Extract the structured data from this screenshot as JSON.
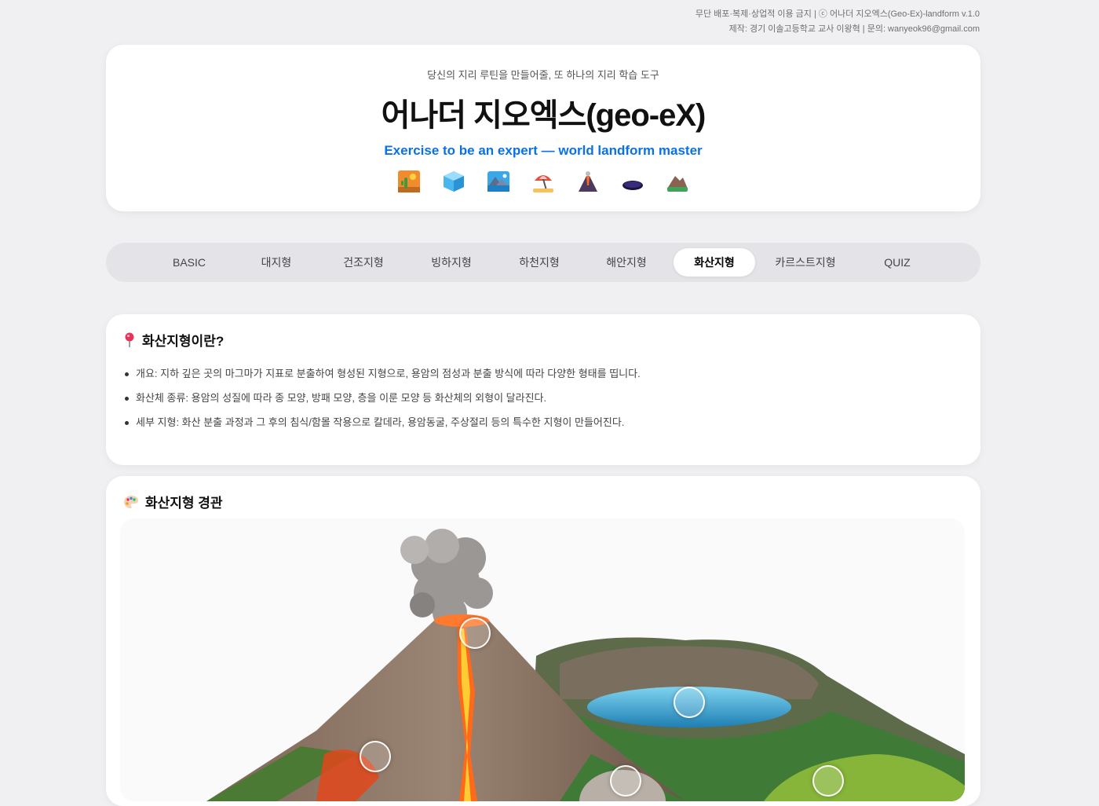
{
  "copyright": {
    "line1": "무단 배포·복제·상업적 이용 금지 | ⓒ 어나더 지오엑스(Geo-Ex)-landform v.1.0",
    "line2": "제작: 경기 이솔고등학교 교사 이왕혁 | 문의: wanyeok96@gmail.com"
  },
  "hero": {
    "tagline": "당신의 지리 루틴을 만들어줄, 또 하나의 지리 학습 도구",
    "title": "어나더 지오엑스(geo-eX)",
    "subtitle": "Exercise to be an expert — world landform master",
    "icons": [
      "desert-icon",
      "ice-cube-icon",
      "landscape-icon",
      "beach-umbrella-icon",
      "volcano-icon",
      "hole-icon",
      "mountain-icon"
    ]
  },
  "tabs": [
    {
      "label": "BASIC",
      "active": false
    },
    {
      "label": "대지형",
      "active": false
    },
    {
      "label": "건조지형",
      "active": false
    },
    {
      "label": "빙하지형",
      "active": false
    },
    {
      "label": "하천지형",
      "active": false
    },
    {
      "label": "해안지형",
      "active": false
    },
    {
      "label": "화산지형",
      "active": true
    },
    {
      "label": "카르스트지형",
      "active": false
    },
    {
      "label": "QUIZ",
      "active": false
    }
  ],
  "intro": {
    "icon": "pin-icon",
    "heading": "화산지형이란?",
    "bullets": [
      "개요: 지하 깊은 곳의 마그마가 지표로 분출하여 형성된 지형으로, 용암의 점성과 분출 방식에 따라 다양한 형태를 띱니다.",
      "화산체 종류: 용암의 성질에 따라 종 모양, 방패 모양, 층을 이룬 모양 등 화산체의 외형이 달라진다.",
      "세부 지형: 화산 분출 과정과 그 후의 침식/함몰 작용으로 칼데라, 용암동굴, 주상절리 등의 특수한 지형이 만들어진다."
    ]
  },
  "landscape": {
    "icon": "palette-icon",
    "heading": "화산지형 경관"
  },
  "colors": {
    "accent": "#0a71e6",
    "background": "#f0f0f3",
    "tab_bar": "#e4e4e8"
  }
}
